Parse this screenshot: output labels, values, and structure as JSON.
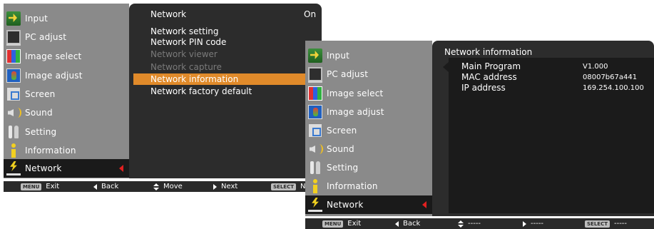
{
  "menu": {
    "items": [
      {
        "label": "Input",
        "icon": "input-icon"
      },
      {
        "label": "PC adjust",
        "icon": "pc-adjust-icon"
      },
      {
        "label": "Image select",
        "icon": "image-select-icon"
      },
      {
        "label": "Image adjust",
        "icon": "image-adjust-icon"
      },
      {
        "label": "Screen",
        "icon": "screen-icon"
      },
      {
        "label": "Sound",
        "icon": "sound-icon"
      },
      {
        "label": "Setting",
        "icon": "setting-icon"
      },
      {
        "label": "Information",
        "icon": "information-icon"
      },
      {
        "label": "Network",
        "icon": "network-icon",
        "selected": true
      }
    ]
  },
  "network_menu": {
    "items": [
      {
        "label": "Network",
        "value": "On"
      },
      {
        "label": "Network setting"
      },
      {
        "label": "Network PIN code"
      },
      {
        "label": "Network viewer",
        "disabled": true
      },
      {
        "label": "Network capture",
        "disabled": true
      },
      {
        "label": "Network information",
        "highlighted": true
      },
      {
        "label": "Network factory default"
      }
    ]
  },
  "network_info": {
    "title": "Network information",
    "rows": [
      {
        "label": "Main Program",
        "value": "V1.000"
      },
      {
        "label": "MAC address",
        "value": "08007b67a441"
      },
      {
        "label": "IP address",
        "value": "169.254.100.100"
      }
    ]
  },
  "status_bar_1": {
    "exit_key": "MENU",
    "exit_label": "Exit",
    "back_label": "Back",
    "move_label": "Move",
    "next_label": "Next",
    "select_key": "SELECT",
    "select_label": "N"
  },
  "status_bar_2": {
    "exit_key": "MENU",
    "exit_label": "Exit",
    "back_label": "Back",
    "move_label": "-----",
    "next_label": "-----",
    "select_key": "SELECT",
    "select_label": "-----"
  },
  "colors": {
    "highlight": "#e08a2a",
    "menu_bg": "#8a8a8a",
    "panel_bg": "#2c2c2c",
    "cursor": "#e22020"
  }
}
